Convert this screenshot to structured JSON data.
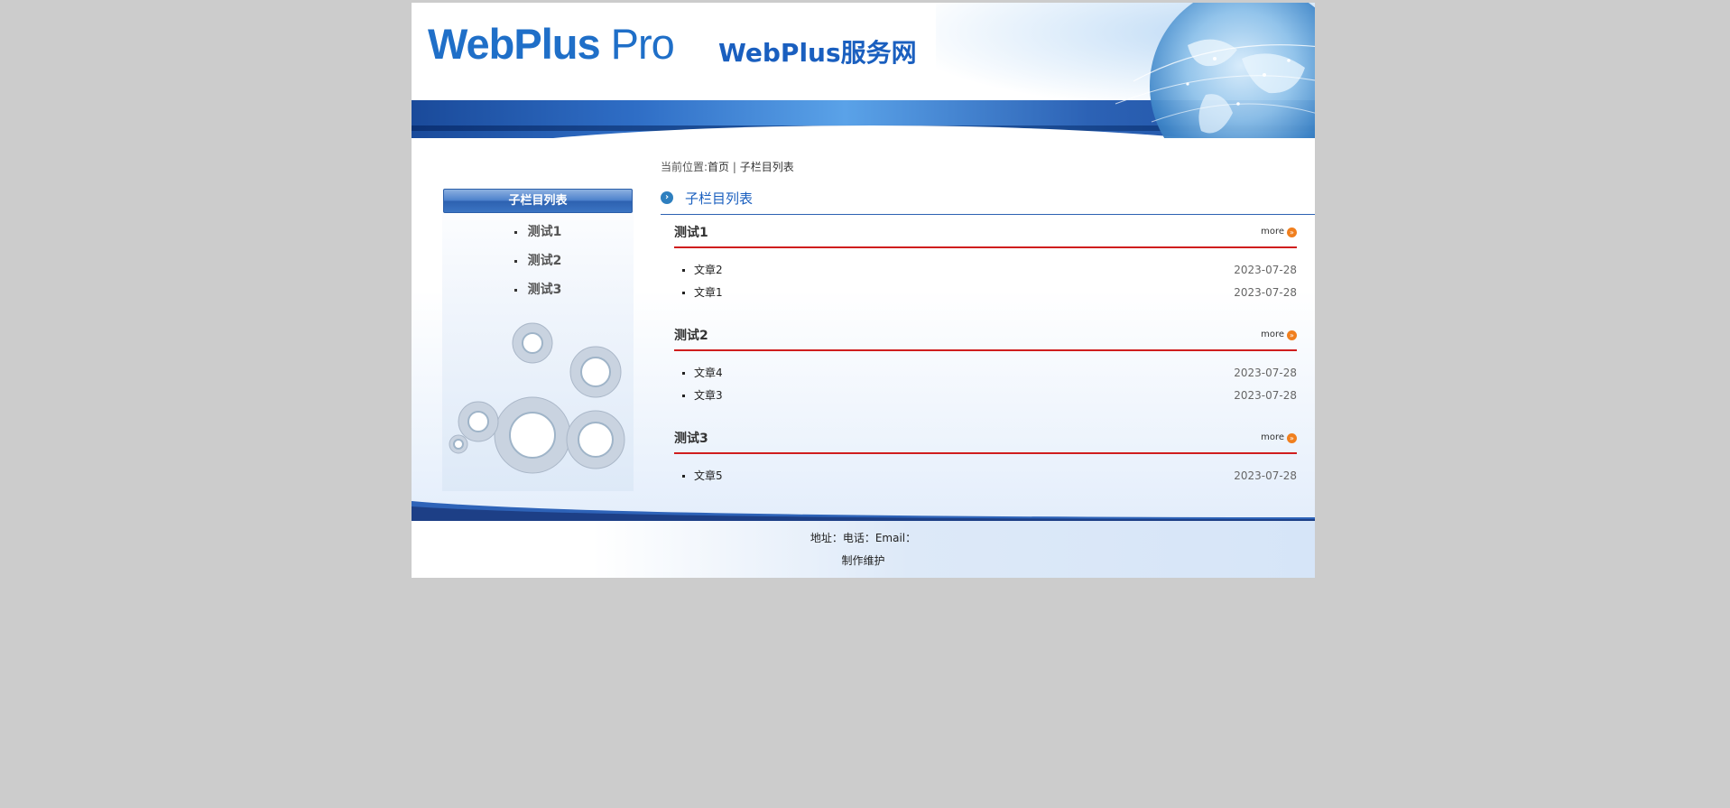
{
  "header": {
    "logo_bold": "WebPlus",
    "logo_light": " Pro",
    "site_name": "WebPlus服务网"
  },
  "sidebar": {
    "title": "子栏目列表",
    "items": [
      {
        "label": "测试1"
      },
      {
        "label": "测试2"
      },
      {
        "label": "测试3"
      }
    ]
  },
  "breadcrumb": {
    "prefix": "当前位置:",
    "home": "首页",
    "separator": " | ",
    "current": "子栏目列表"
  },
  "column": {
    "title": "子栏目列表"
  },
  "sections": [
    {
      "title": "测试1",
      "more": "more",
      "articles": [
        {
          "title": "文章2",
          "date": "2023-07-28"
        },
        {
          "title": "文章1",
          "date": "2023-07-28"
        }
      ]
    },
    {
      "title": "测试2",
      "more": "more",
      "articles": [
        {
          "title": "文章4",
          "date": "2023-07-28"
        },
        {
          "title": "文章3",
          "date": "2023-07-28"
        }
      ]
    },
    {
      "title": "测试3",
      "more": "more",
      "articles": [
        {
          "title": "文章5",
          "date": "2023-07-28"
        }
      ]
    }
  ],
  "footer": {
    "contact": "地址：电话：Email：",
    "maintain": "制作维护"
  },
  "colors": {
    "background": "#cccccc",
    "brand_blue": "#1f6fc8",
    "section_rule": "#d01e1e",
    "more_icon": "#f07f1e"
  }
}
